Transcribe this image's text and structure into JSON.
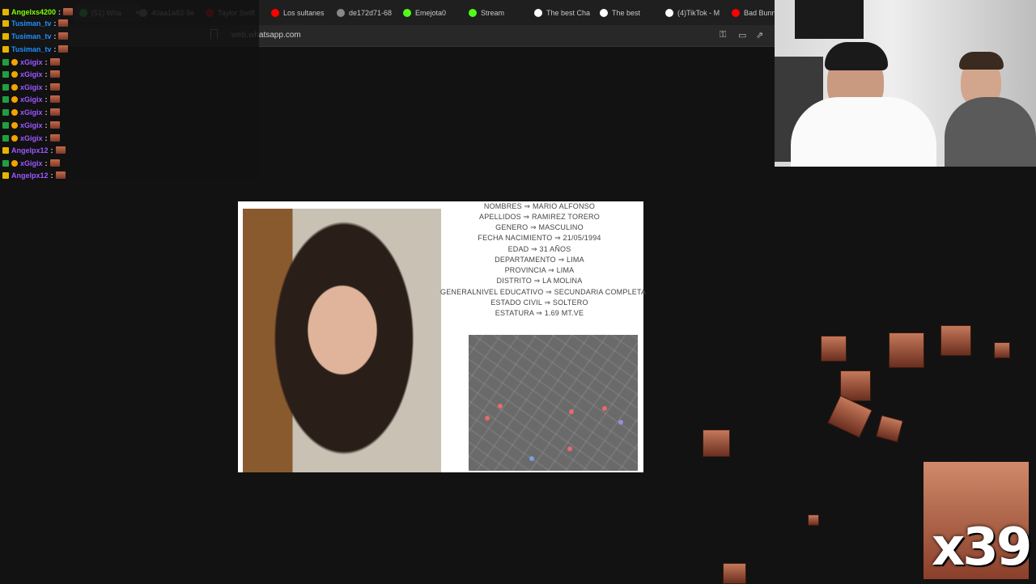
{
  "browser": {
    "tabs": [
      {
        "label": "(51) Wha",
        "icon": "whatsapp-icon",
        "color": "#25d366",
        "active": true,
        "close_glyph": "×"
      },
      {
        "label": "40aa1a83-9e",
        "icon": "globe-icon",
        "color": "#888888"
      },
      {
        "label": "Taylor Swift",
        "icon": "youtube-icon",
        "color": "#ff0000"
      },
      {
        "label": "Los sultanes",
        "icon": "youtube-icon",
        "color": "#ff0000"
      },
      {
        "label": "de172d71-68",
        "icon": "globe-icon",
        "color": "#888888"
      },
      {
        "label": "Emejota0",
        "icon": "kick-icon",
        "color": "#53fc18"
      },
      {
        "label": "Stream",
        "icon": "kick-icon",
        "color": "#53fc18"
      },
      {
        "label": "The best Cha",
        "icon": "diamond-icon",
        "color": "#ffffff"
      },
      {
        "label": "The best",
        "icon": "diamond-icon",
        "color": "#ffffff"
      },
      {
        "label": "(4)TikTok - M",
        "icon": "tiktok-icon",
        "color": "#ffffff"
      },
      {
        "label": "Bad Bunny",
        "icon": "youtube-icon",
        "color": "#ff0000"
      }
    ],
    "url": "web.whatsapp.com"
  },
  "chat": {
    "messages": [
      {
        "user": "Angelxs4200",
        "color": "#7fff00"
      },
      {
        "user": "Tusiman_tv",
        "color": "#1e90ff"
      },
      {
        "user": "Tusiman_tv",
        "color": "#1e90ff"
      },
      {
        "user": "Tusiman_tv",
        "color": "#1e90ff"
      },
      {
        "user": "xGigix",
        "color": "#9b59ff"
      },
      {
        "user": "xGigix",
        "color": "#9b59ff"
      },
      {
        "user": "xGigix",
        "color": "#9b59ff"
      },
      {
        "user": "xGigix",
        "color": "#9b59ff"
      },
      {
        "user": "xGigix",
        "color": "#9b59ff"
      },
      {
        "user": "xGigix",
        "color": "#9b59ff"
      },
      {
        "user": "xGigix",
        "color": "#9b59ff"
      },
      {
        "user": "Angelpx12",
        "color": "#9b59ff"
      },
      {
        "user": "xGigix",
        "color": "#9b59ff"
      },
      {
        "user": "Angelpx12",
        "color": "#9b59ff"
      }
    ],
    "colon": ":"
  },
  "document": {
    "fields": [
      "NOMBRES ⇒ MARIO ALFONSO",
      "APELLIDOS ⇒ RAMIREZ TORERO",
      "GENERO ⇒ MASCULINO",
      "FECHA NACIMIENTO ⇒ 21/05/1994",
      "EDAD ⇒ 31 AÑOS",
      "DEPARTAMENTO ⇒ LIMA",
      "PROVINCIA ⇒ LIMA",
      "DISTRITO ⇒ LA MOLINA",
      "GENERALNIVEL EDUCATIVO ⇒ SECUNDARIA COMPLETA",
      "ESTADO CIVIL ⇒ SOLTERO",
      "ESTATURA ⇒ 1.69 MT.VE"
    ]
  },
  "overlay": {
    "combo_text": "x39"
  }
}
